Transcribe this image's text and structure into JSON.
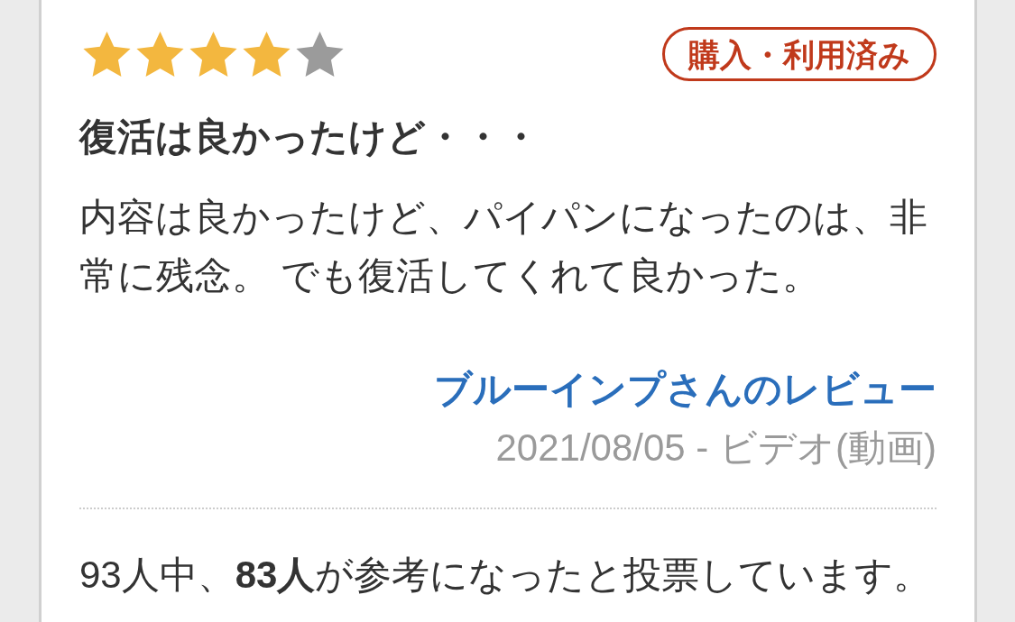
{
  "review": {
    "stars": 4,
    "badge": "購入・利用済み",
    "title": "復活は良かったけど・・・",
    "body": "内容は良かったけど、パイパンになったのは、非常に残念。 でも復活してくれて良かった。",
    "reviewer": "ブルーインプさんのレビュー",
    "meta": "2021/08/05 - ビデオ(動画)",
    "helpful": "93人中、**83人**が参考になったと投票しています。"
  }
}
